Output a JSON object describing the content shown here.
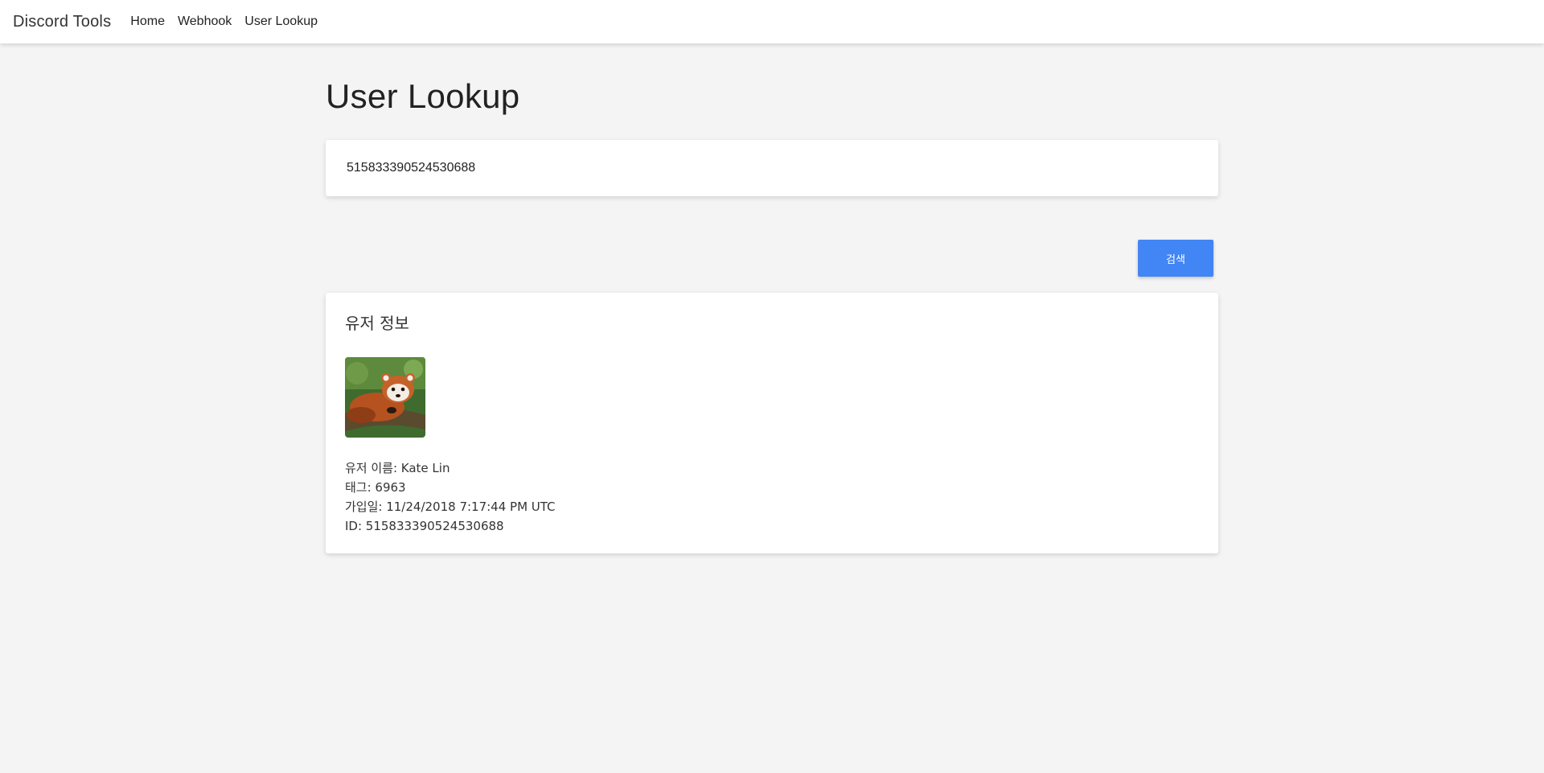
{
  "nav": {
    "brand": "Discord Tools",
    "links": [
      "Home",
      "Webhook",
      "User Lookup"
    ]
  },
  "page": {
    "title": "User Lookup"
  },
  "search": {
    "value": "515833390524530688",
    "button_label": "검색"
  },
  "user_info": {
    "heading": "유저 정보",
    "lines": [
      "유저 이름: Kate Lin",
      "태그: 6963",
      "가입일: 11/24/2018 7:17:44 PM UTC",
      "ID: 515833390524530688"
    ]
  },
  "colors": {
    "accent": "#4285f4",
    "background": "#f4f4f4"
  }
}
